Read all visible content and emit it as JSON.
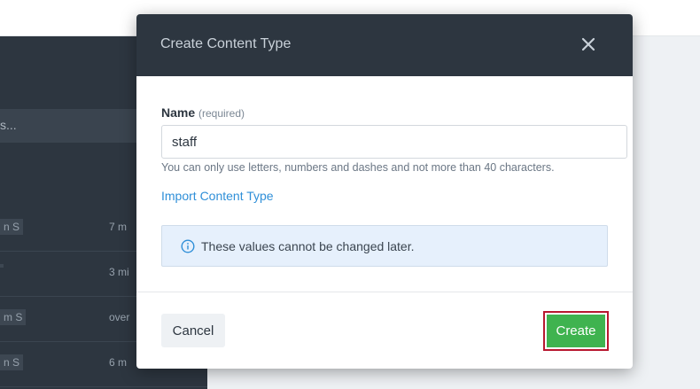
{
  "background": {
    "search_placeholder": "s...",
    "rows": [
      {
        "tag": "n S",
        "time": "7 m"
      },
      {
        "tag": "",
        "time": "3 mi"
      },
      {
        "tag": "m S",
        "time": "over"
      },
      {
        "tag": "n S",
        "time": "6 m"
      }
    ]
  },
  "modal": {
    "title": "Create Content Type",
    "close_icon": "close-icon",
    "name_label": "Name",
    "name_required": "(required)",
    "name_value": "staff",
    "helper_text": "You can only use letters, numbers and dashes and not more than 40 characters.",
    "import_link": "Import Content Type",
    "info_icon": "info-icon",
    "info_text": "These values cannot be changed later.",
    "cancel_label": "Cancel",
    "create_label": "Create"
  },
  "colors": {
    "header_bg": "#2d3640",
    "link": "#2f8fd8",
    "create_bg": "#3fb34f",
    "create_highlight": "#b8182f",
    "info_bg": "#e6f0fc"
  }
}
